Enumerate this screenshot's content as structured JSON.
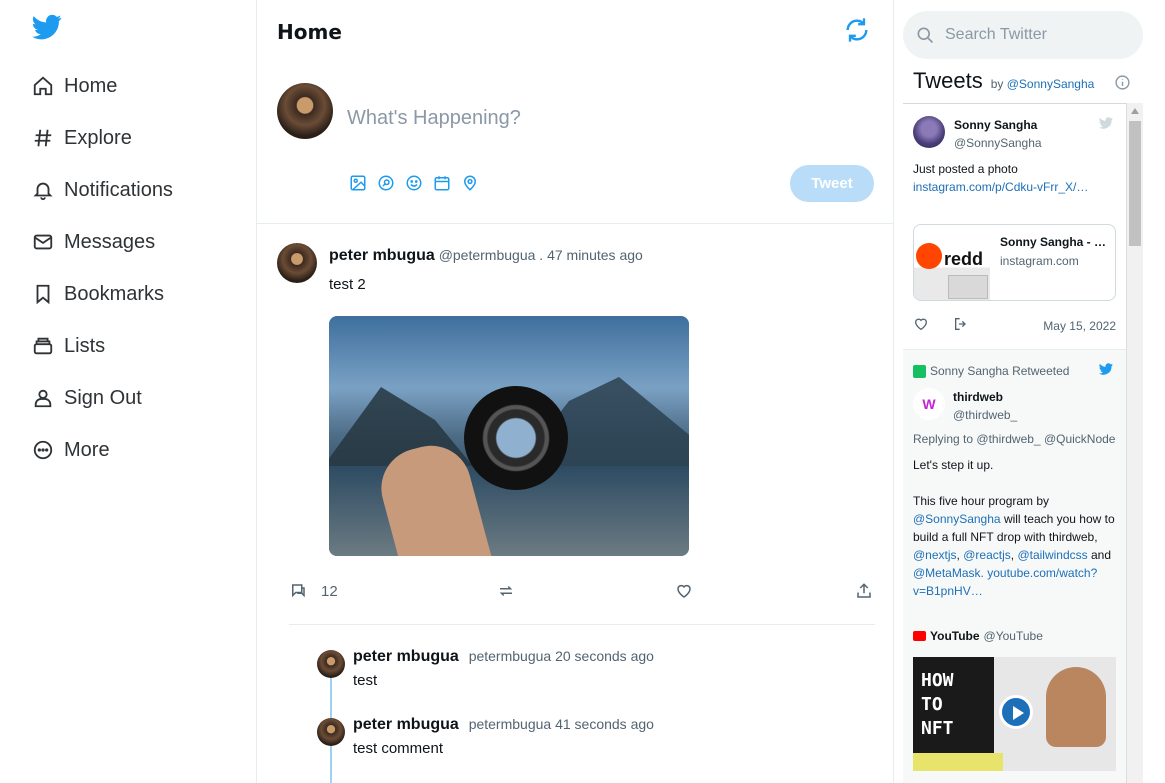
{
  "sidebar": {
    "items": [
      {
        "label": "Home",
        "icon": "home-icon"
      },
      {
        "label": "Explore",
        "icon": "hashtag-icon"
      },
      {
        "label": "Notifications",
        "icon": "bell-icon"
      },
      {
        "label": "Messages",
        "icon": "mail-icon"
      },
      {
        "label": "Bookmarks",
        "icon": "bookmark-icon"
      },
      {
        "label": "Lists",
        "icon": "list-icon"
      },
      {
        "label": "Sign Out",
        "icon": "user-icon"
      },
      {
        "label": "More",
        "icon": "more-icon"
      }
    ]
  },
  "feed": {
    "title": "Home",
    "composer": {
      "placeholder": "What's Happening?",
      "tweet_label": "Tweet",
      "icons": [
        "image-icon",
        "search-icon",
        "emoji-icon",
        "calendar-icon",
        "location-icon"
      ]
    },
    "post": {
      "name": "peter mbugua",
      "meta": "@petermbugua . 47 minutes ago",
      "text": "test 2",
      "comment_count": "12"
    },
    "comments": [
      {
        "name": "peter mbugua",
        "meta": "petermbugua 20 seconds ago",
        "text": "test"
      },
      {
        "name": "peter mbugua",
        "meta": "petermbugua 41 seconds ago",
        "text": "test comment"
      }
    ]
  },
  "right": {
    "search_placeholder": "Search Twitter",
    "tweets_title": "Tweets",
    "tweets_by": "by",
    "tweets_by_handle": "@SonnySangha",
    "tweet1": {
      "name": "Sonny Sangha",
      "handle": "@SonnySangha",
      "text": "Just posted a photo",
      "link": "instagram.com/p/Cdku-vFrr_X/…",
      "card_title": "Sonny Sangha - …",
      "card_domain": "instagram.com",
      "card_thumb_text": "redd",
      "date": "May 15, 2022"
    },
    "tweet2": {
      "retweet_label": "Sonny Sangha Retweeted",
      "name": "thirdweb",
      "handle": "@thirdweb_",
      "logo_text": "W",
      "reply_prefix": "Replying to",
      "reply_to": "@thirdweb_ @QuickNode",
      "line1": "Let's step it up.",
      "line2a": "This five hour program by",
      "mention1": "@SonnySangha",
      "line2b": "will teach you how to build a full NFT drop with thirdweb,",
      "mention2": "@nextjs",
      "sep1": ",",
      "mention3": "@reactjs",
      "sep2": ",",
      "mention4": "@tailwindcss",
      "and": "and",
      "mention5": "@MetaMask.",
      "link": "youtube.com/watch?v=B1pnHV…",
      "yt_name": "YouTube",
      "yt_handle": "@YouTube",
      "yt_thumb_text": "HOW\nTO\nNFT"
    }
  },
  "colors": {
    "accent": "#1d9bf0",
    "tweet_button_disabled": "#b9dcf8",
    "link": "#1d6fb8"
  }
}
